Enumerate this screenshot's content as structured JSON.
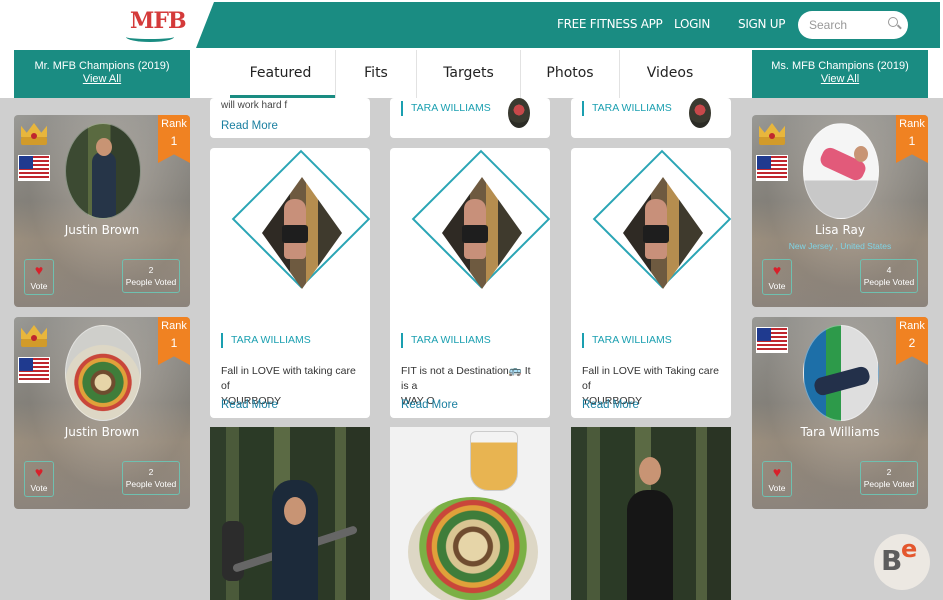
{
  "header": {
    "logo_text": "MFB",
    "nav": [
      "FREE FITNESS APP",
      "LOGIN",
      "SIGN UP"
    ],
    "search_placeholder": "Search"
  },
  "champions": {
    "left_title": "Mr. MFB Champions (2019)",
    "right_title": "Ms. MFB Champions (2019)",
    "view_all": "View All"
  },
  "tabs": [
    "Featured",
    "Fits",
    "Targets",
    "Photos",
    "Videos"
  ],
  "active_tab": "Featured",
  "top_row": {
    "snippet": "will work hard f",
    "read_more": "Read More",
    "author": "TARA WILLIAMS"
  },
  "cards": [
    {
      "author": "TARA WILLIAMS",
      "line1": "Fall in LOVE with taking care of",
      "line2": "YOURBODY",
      "read_more": "Read More"
    },
    {
      "author": "TARA WILLIAMS",
      "line1": "FIT is not a Destination🚌 It is a",
      "line2": "WAY O",
      "read_more": "Read More"
    },
    {
      "author": "TARA WILLIAMS",
      "line1": "Fall in LOVE with Taking care of",
      "line2": "YOURBODY",
      "read_more": "Read More"
    }
  ],
  "left_cards": [
    {
      "rank_label": "Rank",
      "rank": "1",
      "name": "Justin Brown",
      "vote": "Vote",
      "votes_count": "2",
      "votes_label": "People Voted"
    },
    {
      "rank_label": "Rank",
      "rank": "1",
      "name": "Justin Brown",
      "vote": "Vote",
      "votes_count": "2",
      "votes_label": "People Voted"
    }
  ],
  "right_cards": [
    {
      "rank_label": "Rank",
      "rank": "1",
      "name": "Lisa Ray",
      "location": "New Jersey , United States",
      "vote": "Vote",
      "votes_count": "4",
      "votes_label": "People Voted"
    },
    {
      "rank_label": "Rank",
      "rank": "2",
      "name": "Tara Williams",
      "vote": "Vote",
      "votes_count": "2",
      "votes_label": "People Voted"
    }
  ],
  "icons": {
    "crown": "crown-icon",
    "flag": "us-flag-icon",
    "heart": "heart-icon",
    "search": "search-icon"
  },
  "colors": {
    "teal": "#1a8c82",
    "orange": "#f08222",
    "link": "#1a7fa0"
  }
}
